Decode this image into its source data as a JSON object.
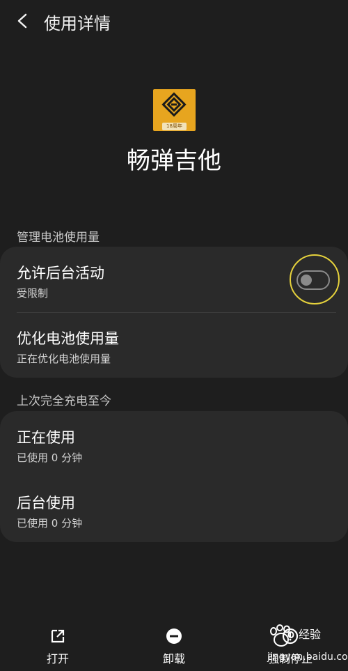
{
  "header": {
    "title": "使用详情"
  },
  "app": {
    "name": "畅弹吉他",
    "badge": "18周年",
    "icon_color": "#e7a51f"
  },
  "battery_section": {
    "label": "管理电池使用量",
    "items": [
      {
        "title": "允许后台活动",
        "subtitle": "受限制",
        "toggle_on": false
      },
      {
        "title": "优化电池使用量",
        "subtitle": "正在优化电池使用量"
      }
    ]
  },
  "usage_section": {
    "label": "上次完全充电至今",
    "items": [
      {
        "title": "正在使用",
        "subtitle": "已使用 0 分钟"
      },
      {
        "title": "后台使用",
        "subtitle": "已使用 0 分钟"
      }
    ]
  },
  "bottom_actions": [
    {
      "label": "打开",
      "icon": "open-external-icon"
    },
    {
      "label": "卸载",
      "icon": "uninstall-icon"
    },
    {
      "label": "强制停止",
      "icon": "force-stop-icon"
    }
  ],
  "watermark": {
    "text": "经验",
    "sub": "jingyan.baidu.com"
  },
  "colors": {
    "background": "#1e1e1e",
    "card": "#2a2a2a",
    "highlight_ring": "#e6d23c",
    "toggle_off": "#8a8a8a"
  }
}
